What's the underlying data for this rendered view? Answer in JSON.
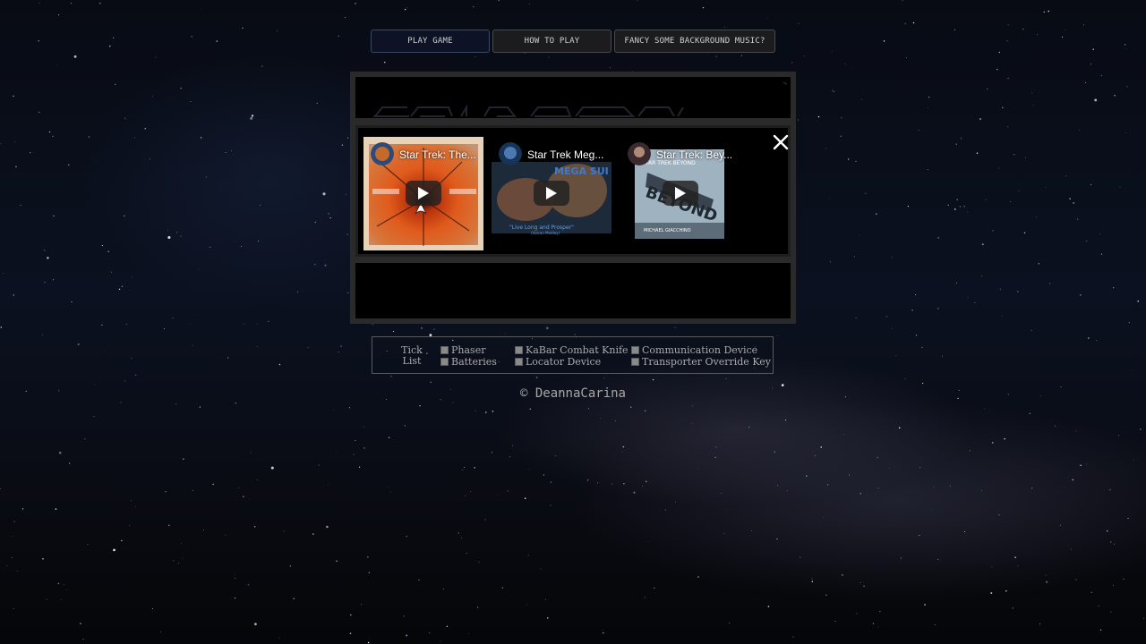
{
  "nav": {
    "play_game": "PLAY GAME",
    "how_to_play": "HOW TO PLAY",
    "music": "FANCY SOME BACKGROUND MUSIC?"
  },
  "music_panel": {
    "videos": [
      {
        "title": "Star Trek: The..."
      },
      {
        "title": "Star Trek Meg..."
      },
      {
        "title": "Star Trek: Bey..."
      }
    ]
  },
  "ticklist": {
    "label_line1": "Tick",
    "label_line2": "List",
    "items": [
      "Phaser",
      "Batteries",
      "KaBar Combat Knife",
      "Locator Device",
      "Communication Device",
      "Transporter Override Key"
    ]
  },
  "footer": {
    "copyright": "© DeannaCarina"
  },
  "colors": {
    "accent": "#0d1324",
    "text": "#cfcfcf",
    "frame": "#2a2a2a"
  }
}
